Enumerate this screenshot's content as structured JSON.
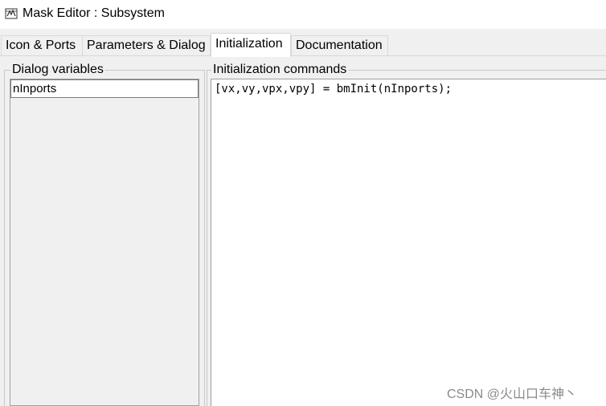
{
  "window": {
    "title": "Mask Editor : Subsystem"
  },
  "tabs": [
    {
      "label": "Icon & Ports",
      "active": false
    },
    {
      "label": "Parameters & Dialog",
      "active": false
    },
    {
      "label": "Initialization",
      "active": true
    },
    {
      "label": "Documentation",
      "active": false
    }
  ],
  "dialog_variables": {
    "title": "Dialog variables",
    "items": [
      "nInports"
    ]
  },
  "initialization": {
    "title": "Initialization commands",
    "commands": "[vx,vy,vpx,vpy] = bmInit(nInports);"
  },
  "watermark": "CSDN @火山口车神丶"
}
